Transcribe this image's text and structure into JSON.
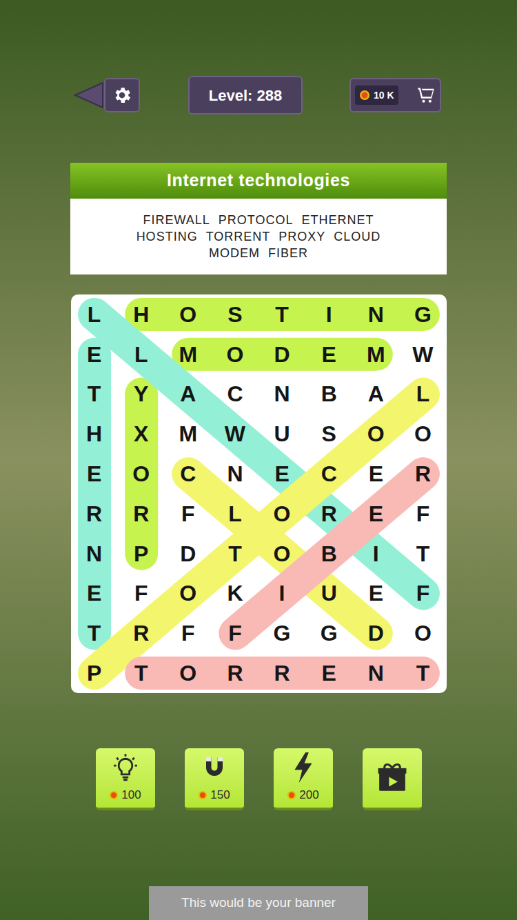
{
  "level": "Level: 288",
  "coins": "10 K",
  "category": "Internet technologies",
  "word_rows": [
    [
      "FIREWALL",
      "PROTOCOL",
      "ETHERNET"
    ],
    [
      "HOSTING",
      "TORRENT",
      "PROXY",
      "CLOUD"
    ],
    [
      "MODEM",
      "FIBER"
    ]
  ],
  "grid": [
    [
      "L",
      "H",
      "O",
      "S",
      "T",
      "I",
      "N",
      "G"
    ],
    [
      "E",
      "L",
      "M",
      "O",
      "D",
      "E",
      "M",
      "W"
    ],
    [
      "T",
      "Y",
      "A",
      "C",
      "N",
      "B",
      "A",
      "L"
    ],
    [
      "H",
      "X",
      "M",
      "W",
      "U",
      "S",
      "O",
      "O"
    ],
    [
      "E",
      "O",
      "C",
      "N",
      "E",
      "C",
      "E",
      "R"
    ],
    [
      "R",
      "R",
      "F",
      "L",
      "O",
      "R",
      "E",
      "F"
    ],
    [
      "N",
      "P",
      "D",
      "T",
      "O",
      "B",
      "I",
      "T"
    ],
    [
      "E",
      "F",
      "O",
      "K",
      "I",
      "U",
      "E",
      "F"
    ],
    [
      "T",
      "R",
      "F",
      "F",
      "G",
      "G",
      "D",
      "O"
    ],
    [
      "P",
      "T",
      "O",
      "R",
      "R",
      "E",
      "N",
      "T"
    ]
  ],
  "found": [
    {
      "start": [
        0,
        1
      ],
      "end": [
        0,
        7
      ],
      "color": "#c6f34e"
    },
    {
      "start": [
        1,
        2
      ],
      "end": [
        1,
        6
      ],
      "color": "#c6f34e"
    },
    {
      "start": [
        6,
        1
      ],
      "end": [
        2,
        1
      ],
      "color": "#c6f34e"
    },
    {
      "start": [
        1,
        0
      ],
      "end": [
        8,
        0
      ],
      "color": "#93f0d6"
    },
    {
      "start": [
        7,
        7
      ],
      "end": [
        0,
        0
      ],
      "color": "#93f0d6"
    },
    {
      "start": [
        9,
        0
      ],
      "end": [
        2,
        7
      ],
      "color": "#f3f56c"
    },
    {
      "start": [
        4,
        2
      ],
      "end": [
        8,
        6
      ],
      "color": "#f3f56c"
    },
    {
      "start": [
        9,
        1
      ],
      "end": [
        9,
        7
      ],
      "color": "#f9b9b5"
    },
    {
      "start": [
        8,
        3
      ],
      "end": [
        4,
        7
      ],
      "color": "#f9b9b5"
    }
  ],
  "boosters": [
    {
      "kind": "hint",
      "price": "100"
    },
    {
      "kind": "magnet",
      "price": "150"
    },
    {
      "kind": "bolt",
      "price": "200"
    },
    {
      "kind": "video"
    }
  ],
  "banner": "This would be your banner"
}
